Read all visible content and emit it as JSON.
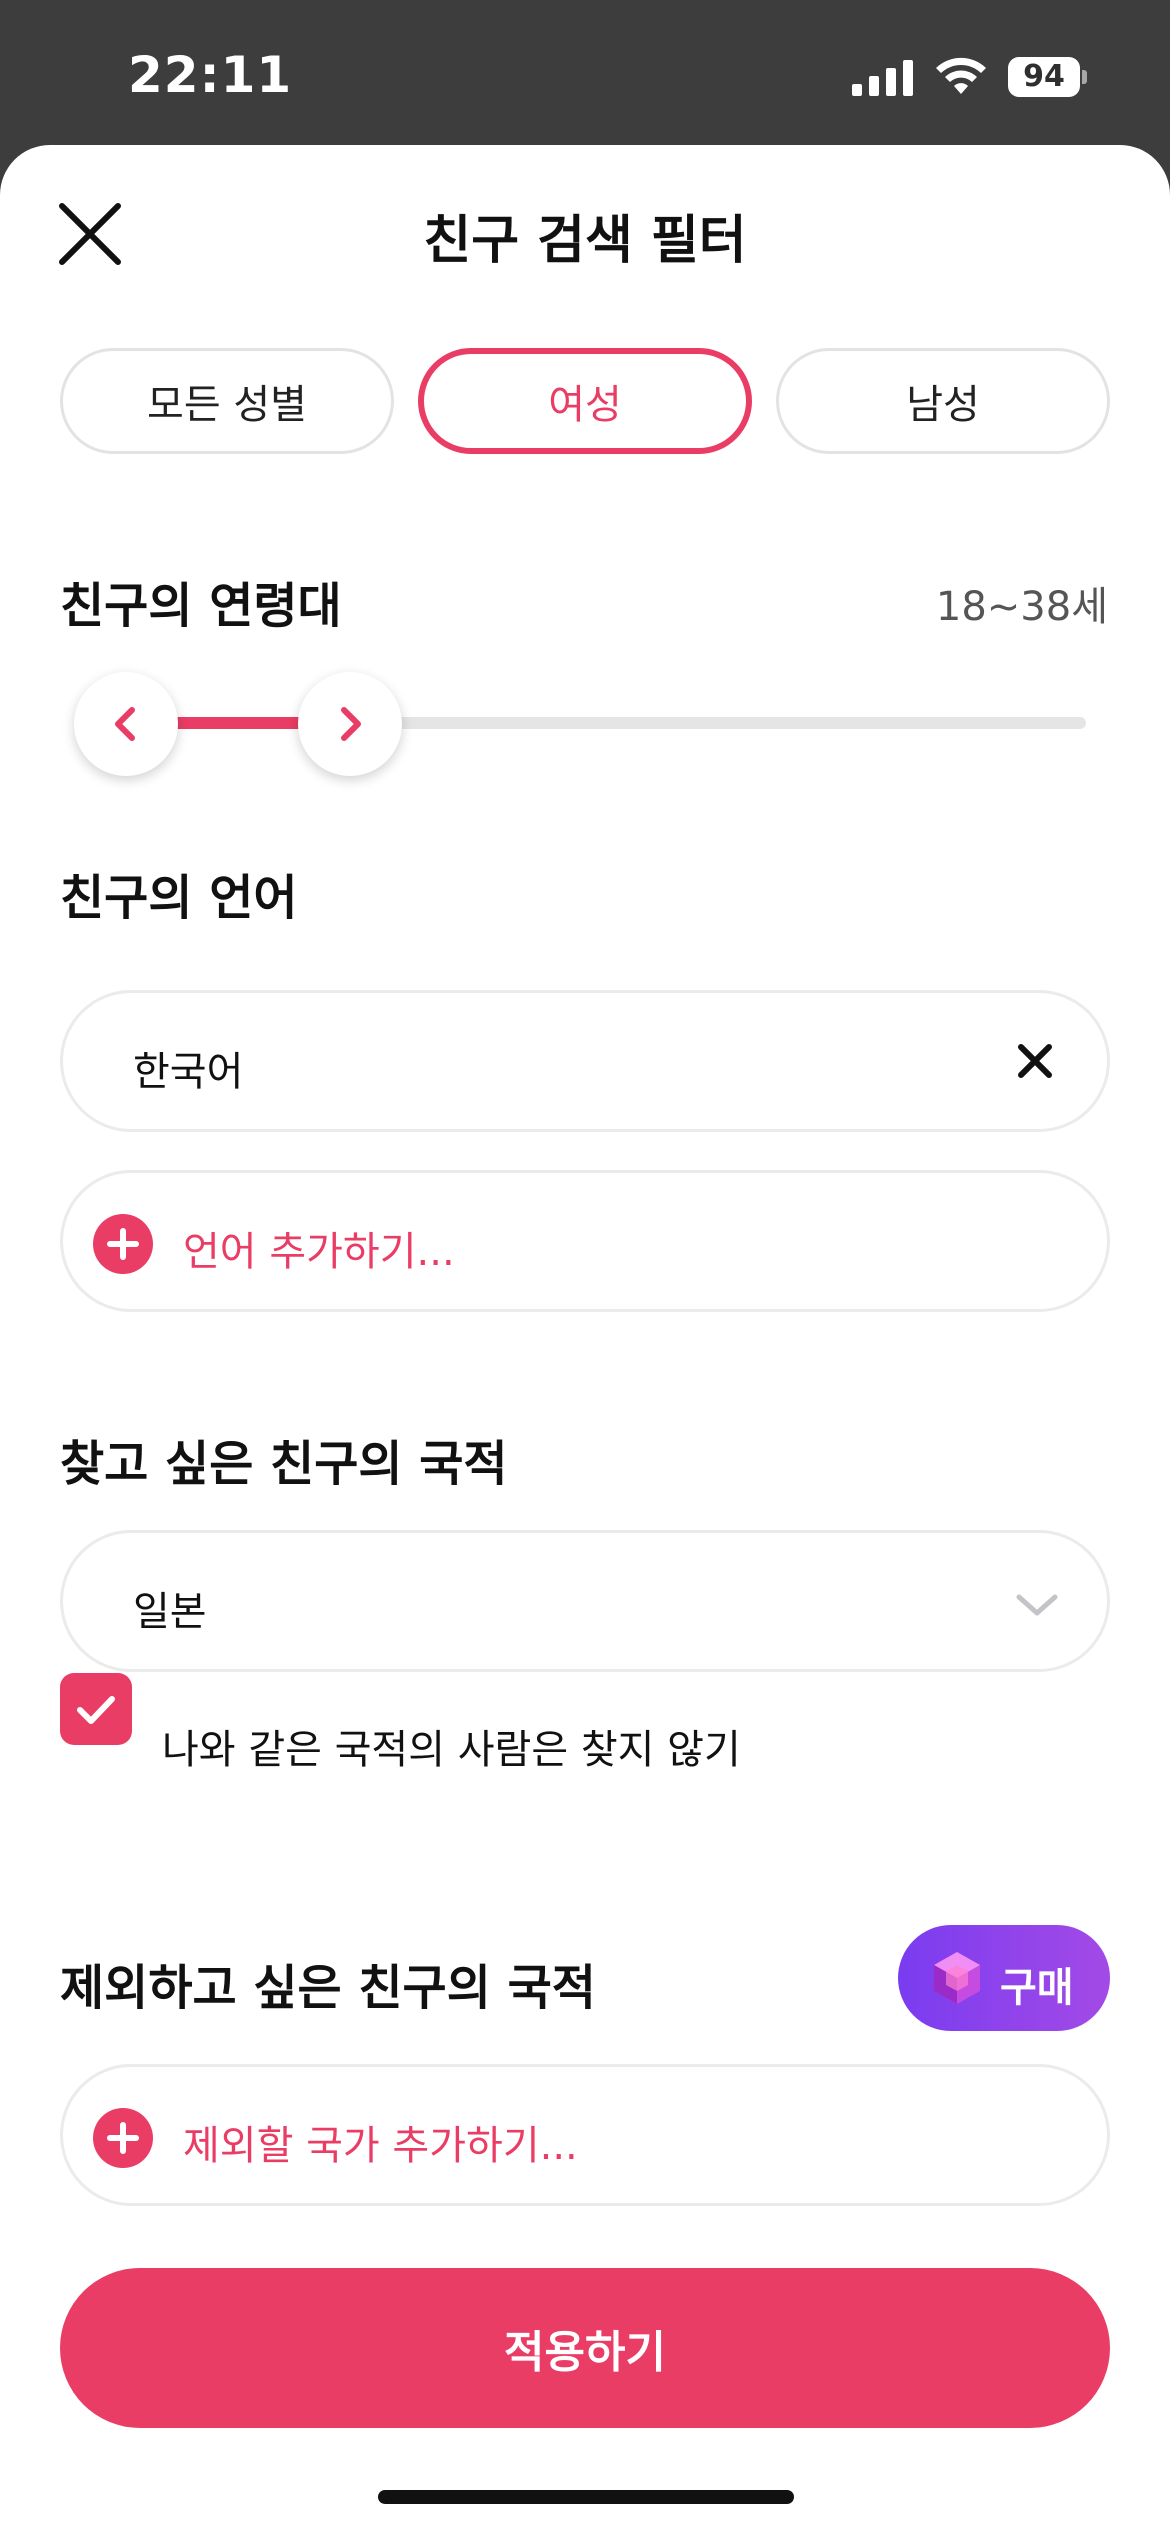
{
  "status_bar": {
    "time": "22:11",
    "battery": "94"
  },
  "header": {
    "title": "친구 검색 필터"
  },
  "gender": {
    "options": [
      "모든 성별",
      "여성",
      "남성"
    ],
    "selected": "여성"
  },
  "age": {
    "title": "친구의 연령대",
    "range": "18~38세",
    "min": 18,
    "max": 38
  },
  "language": {
    "title": "친구의 언어",
    "selected": [
      "한국어"
    ],
    "add_label": "언어 추가하기..."
  },
  "nationality": {
    "title": "찾고 싶은 친구의 국적",
    "selected": "일본",
    "exclude_same_label": "나와 같은 국적의 사람은 찾지 않기",
    "exclude_same_checked": true
  },
  "excluded_nationality": {
    "title": "제외하고 싶은 친구의 국적",
    "buy_label": "구매",
    "add_label": "제외할 국가 추가하기..."
  },
  "apply_label": "적용하기",
  "colors": {
    "accent": "#ea3d65",
    "premium_start": "#7a3cf0",
    "premium_end": "#a34ae6"
  }
}
